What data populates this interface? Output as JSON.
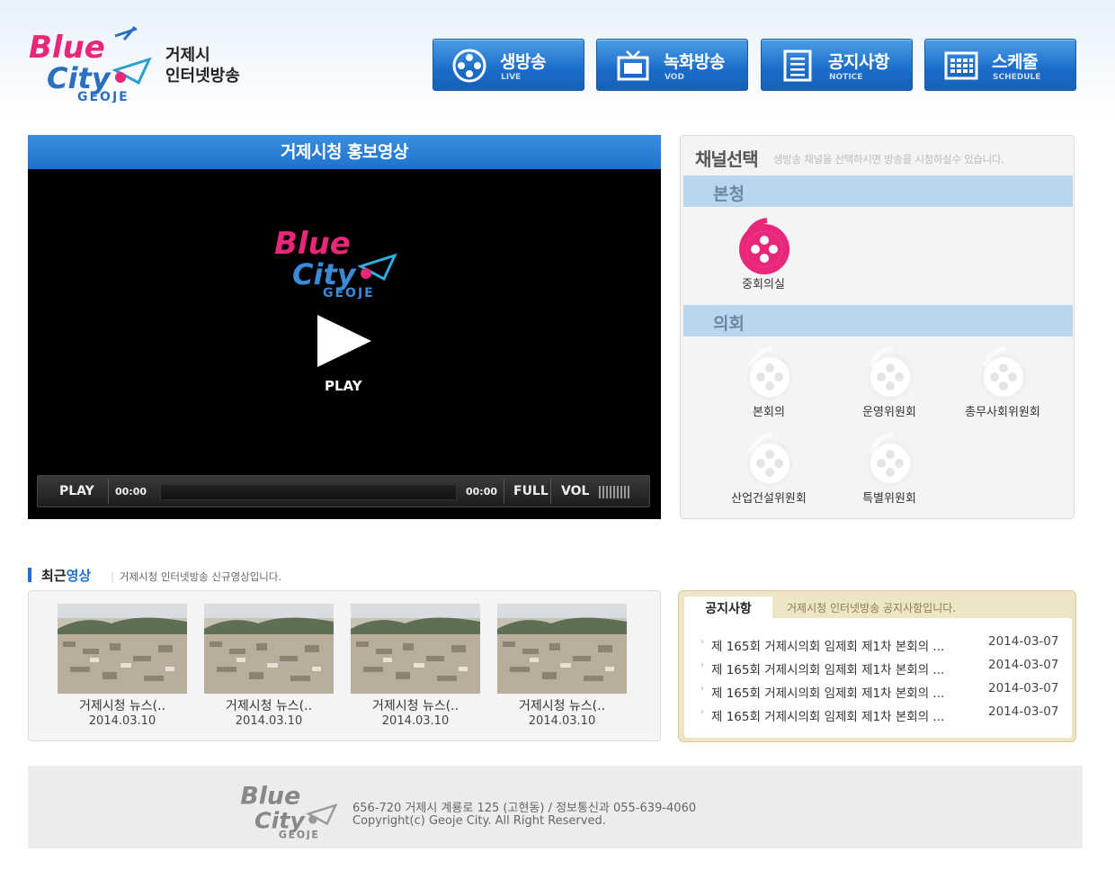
{
  "header": {
    "logo_word1": "Blue",
    "logo_word2": "City",
    "logo_sub": "GEOJE",
    "site_title_line1": "거제시",
    "site_title_line2": "인터넷방송"
  },
  "nav": [
    {
      "label": "생방송",
      "sub": "LIVE",
      "icon": "film-reel-icon"
    },
    {
      "label": "녹화방송",
      "sub": "VOD",
      "icon": "tv-icon"
    },
    {
      "label": "공지사항",
      "sub": "NOTICE",
      "icon": "document-list-icon"
    },
    {
      "label": "스케줄",
      "sub": "SCHEDULE",
      "icon": "calendar-grid-icon"
    }
  ],
  "player": {
    "title": "거제시청 홍보영상",
    "play_label": "PLAY",
    "ctrl_play": "PLAY",
    "time_current": "00:00",
    "time_total": "00:00",
    "full_label": "FULL",
    "vol_label": "VOL"
  },
  "channel": {
    "title": "채널선택",
    "description": "생방송 채널을 선택하시면 방송을 시청하실수 있습니다.",
    "sections": [
      {
        "name": "본청",
        "items": [
          {
            "label": "중회의실",
            "active": true
          }
        ]
      },
      {
        "name": "의회",
        "items": [
          {
            "label": "본회의",
            "active": false
          },
          {
            "label": "운영위원회",
            "active": false
          },
          {
            "label": "총무사회위원회",
            "active": false
          },
          {
            "label": "산업건설위원회",
            "active": false
          },
          {
            "label": "특별위원회",
            "active": false
          }
        ]
      }
    ]
  },
  "recent": {
    "title_plain": "최근",
    "title_accent": "영상",
    "description": "거제시청 인터넷방송 신규영상입니다.",
    "videos": [
      {
        "title": "거제시청 뉴스(..",
        "date": "2014.03.10"
      },
      {
        "title": "거제시청 뉴스(..",
        "date": "2014.03.10"
      },
      {
        "title": "거제시청 뉴스(..",
        "date": "2014.03.10"
      },
      {
        "title": "거제시청 뉴스(..",
        "date": "2014.03.10"
      }
    ]
  },
  "notice": {
    "tab": "공지사항",
    "description": "거제시청 인터넷방송 공지사항입니다.",
    "items": [
      {
        "title": "제 165회 거제시의회 임제회 제1차 본회의 ...",
        "date": "2014-03-07"
      },
      {
        "title": "제 165회 거제시의회 임제회 제1차 본회의 ...",
        "date": "2014-03-07"
      },
      {
        "title": "제 165회 거제시의회 임제회 제1차 본회의 ...",
        "date": "2014-03-07"
      },
      {
        "title": "제 165회 거제시의회 임제회 제1차 본회의 ...",
        "date": "2014-03-07"
      }
    ]
  },
  "footer": {
    "address": "656-720 거제시 계룡로 125 (고현동) / 정보통신과 055-639-4060",
    "copyright": "Copyright(c) Geoje City. All Right Reserved."
  },
  "colors": {
    "brand_blue": "#1e72cc",
    "active_channel": "#e8277a",
    "section_bg": "#b8d6ed",
    "notice_border": "#ede5c3"
  }
}
